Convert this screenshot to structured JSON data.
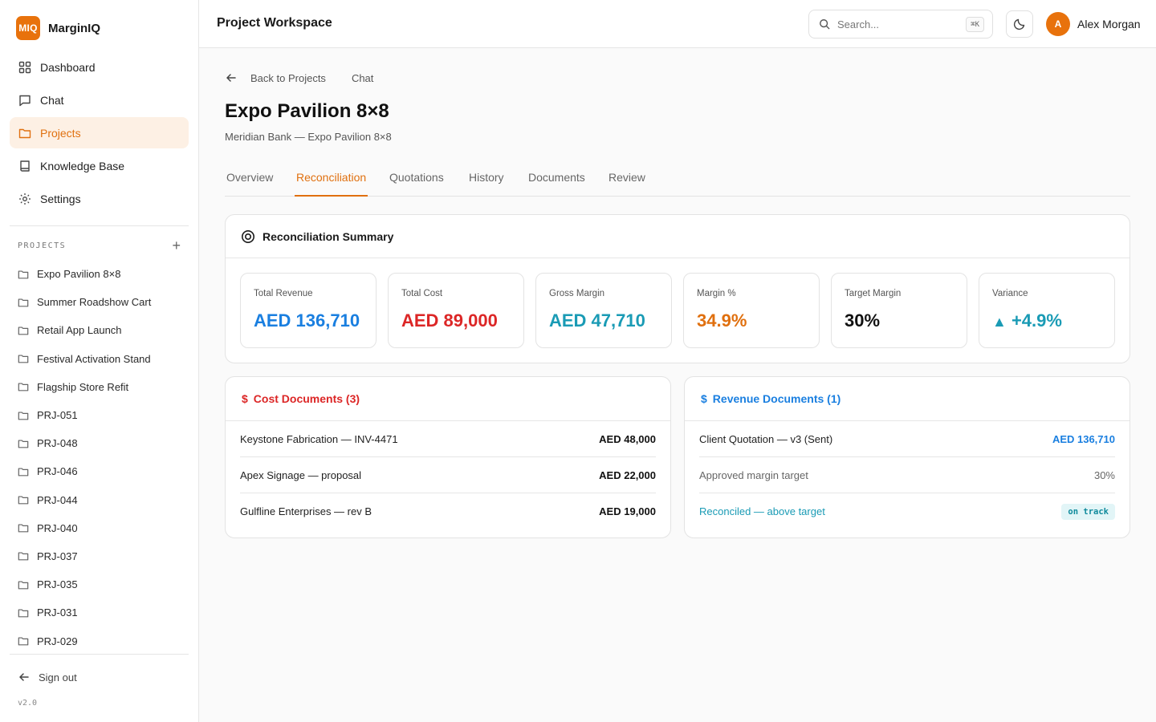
{
  "app": {
    "logo_text": "MIQ",
    "name": "MarginIQ",
    "version": "v2.0"
  },
  "nav": [
    {
      "label": "Dashboard",
      "icon": "grid-icon"
    },
    {
      "label": "Chat",
      "icon": "message-icon"
    },
    {
      "label": "Projects",
      "icon": "folder-icon",
      "active": true
    },
    {
      "label": "Knowledge Base",
      "icon": "book-icon"
    },
    {
      "label": "Settings",
      "icon": "gear-icon"
    }
  ],
  "projects": {
    "header": "PROJECTS",
    "add_label": "+",
    "items": [
      "Expo Pavilion 8×8",
      "Summer Roadshow Cart",
      "Retail App Launch",
      "Festival Activation Stand",
      "Flagship Store Refit",
      "PRJ-051",
      "PRJ-048",
      "PRJ-046",
      "PRJ-044",
      "PRJ-040",
      "PRJ-037",
      "PRJ-035",
      "PRJ-031",
      "PRJ-029"
    ]
  },
  "signout_label": "Sign out",
  "topbar": {
    "title": "Project Workspace",
    "search_placeholder": "Search...",
    "search_shortcut": "⌘K",
    "user_initial": "A",
    "user_name": "Alex Morgan"
  },
  "breadcrumb": {
    "back": "Back to Projects",
    "current": "Chat"
  },
  "page": {
    "title": "Expo Pavilion 8×8",
    "subtitle": "Meridian Bank — Expo Pavilion 8×8"
  },
  "tabs": [
    "Overview",
    "Reconciliation",
    "Quotations",
    "History",
    "Documents",
    "Review"
  ],
  "active_tab": "Reconciliation",
  "summary": {
    "title": "Reconciliation Summary",
    "metrics": [
      {
        "label": "Total Revenue",
        "value": "AED 136,710",
        "color": "#1a7fe0"
      },
      {
        "label": "Total Cost",
        "value": "AED 89,000",
        "color": "#dc2626"
      },
      {
        "label": "Gross Margin",
        "value": "AED 47,710",
        "color": "#1a9bb5"
      },
      {
        "label": "Margin %",
        "value": "34.9%",
        "color": "#e0700f"
      },
      {
        "label": "Target Margin",
        "value": "30%",
        "color": "#111111"
      },
      {
        "label": "Variance",
        "value": "+4.9%",
        "prefix": "▲",
        "color": "#1a9bb5"
      }
    ]
  },
  "cost_docs": {
    "title": "Cost Documents (3)",
    "color": "#dc2626",
    "rows": [
      {
        "name": "Keystone Fabrication — INV-4471",
        "amount": "AED 48,000"
      },
      {
        "name": "Apex Signage — proposal",
        "amount": "AED 22,000"
      },
      {
        "name": "Gulfline Enterprises — rev B",
        "amount": "AED 19,000"
      }
    ]
  },
  "revenue_docs": {
    "title": "Revenue Documents (1)",
    "color": "#1a7fe0",
    "rows": [
      {
        "name": "Client Quotation — v3 (Sent)",
        "amount": "AED 136,710"
      },
      {
        "name": "Approved margin target",
        "amount": "30%"
      },
      {
        "name": "Reconciled — above target",
        "badge": "on track"
      }
    ]
  }
}
